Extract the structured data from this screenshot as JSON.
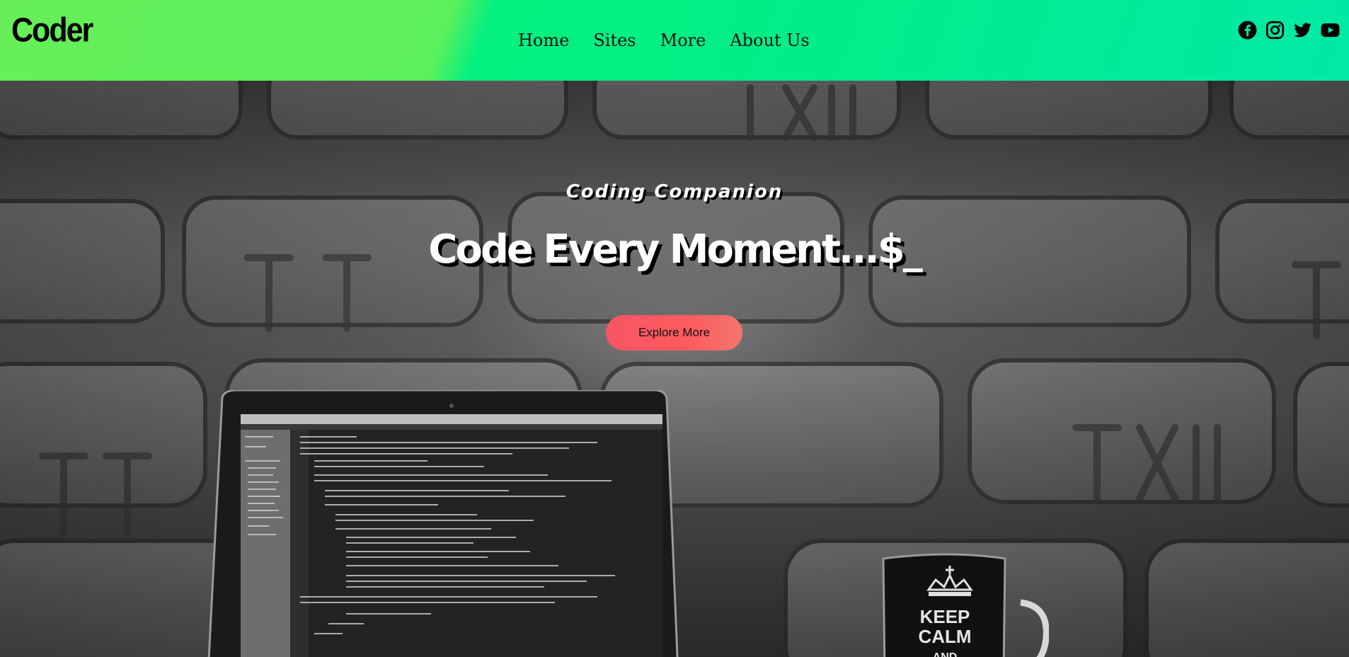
{
  "header": {
    "logo": "Coder",
    "nav": [
      {
        "label": "Home"
      },
      {
        "label": "Sites"
      },
      {
        "label": "More"
      },
      {
        "label": "About Us"
      }
    ],
    "social_icons": [
      "facebook-icon",
      "instagram-icon",
      "twitter-icon",
      "youtube-icon"
    ]
  },
  "hero": {
    "subtitle": "Coding Companion",
    "title": "Code Every Moment...$_",
    "button_label": "Explore More",
    "mug_text": [
      "KEEP",
      "CALM",
      "AND"
    ]
  },
  "colors": {
    "header_green": "#5cf05c",
    "header_teal": "#00e9a6",
    "button_red": "#ff5a5f"
  }
}
